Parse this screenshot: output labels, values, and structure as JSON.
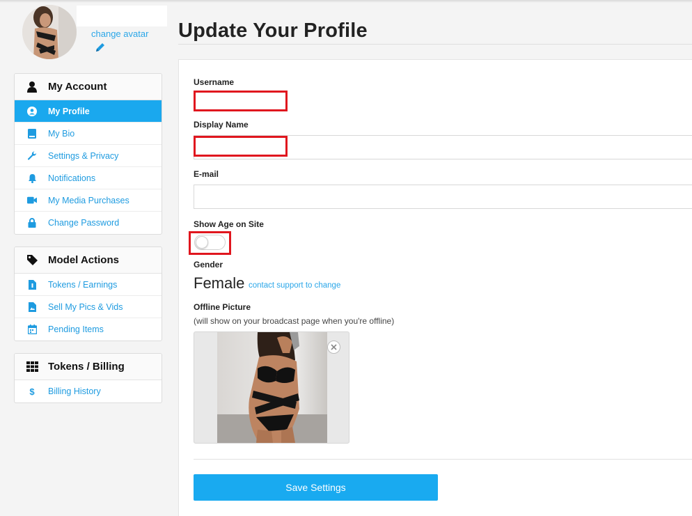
{
  "profile": {
    "change_avatar_label": "change avatar"
  },
  "sidebar": {
    "my_account": {
      "title": "My Account",
      "icon": "user-icon",
      "items": [
        {
          "label": "My Profile",
          "icon": "user-circle-icon",
          "active": true
        },
        {
          "label": "My Bio",
          "icon": "book-icon"
        },
        {
          "label": "Settings & Privacy",
          "icon": "wrench-icon"
        },
        {
          "label": "Notifications",
          "icon": "bell-icon"
        },
        {
          "label": "My Media Purchases",
          "icon": "video-camera-icon"
        },
        {
          "label": "Change Password",
          "icon": "lock-icon"
        }
      ]
    },
    "model_actions": {
      "title": "Model Actions",
      "icon": "tag-icon",
      "items": [
        {
          "label": "Tokens / Earnings",
          "icon": "document-icon"
        },
        {
          "label": "Sell My Pics & Vids",
          "icon": "file-image-icon"
        },
        {
          "label": "Pending Items",
          "icon": "calendar-icon"
        }
      ]
    },
    "tokens_billing": {
      "title": "Tokens / Billing",
      "icon": "grid-icon",
      "items": [
        {
          "label": "Billing History",
          "icon": "dollar-icon"
        }
      ]
    }
  },
  "main": {
    "title": "Update Your Profile",
    "username_label": "Username",
    "username_value": "",
    "display_name_label": "Display Name",
    "display_name_value": "",
    "email_label": "E-mail",
    "email_value": "",
    "show_age_label": "Show Age on Site",
    "show_age_on": false,
    "gender_label": "Gender",
    "gender_value": "Female",
    "gender_change_link": "contact support to change",
    "offline_picture_label": "Offline Picture",
    "offline_picture_hint": "(will show on your broadcast page when you're offline)",
    "save_button": "Save Settings"
  },
  "colors": {
    "accent": "#1aa8ee",
    "link": "#2aa6e8",
    "redaction_box": "#e0161e"
  }
}
